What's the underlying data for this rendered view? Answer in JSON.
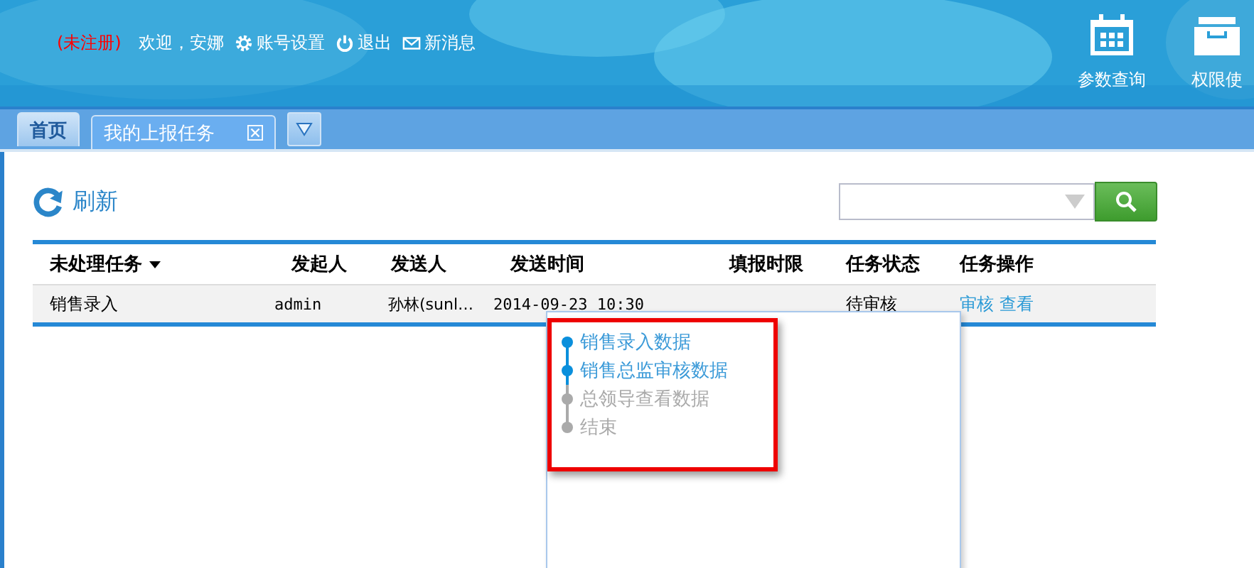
{
  "header": {
    "unregistered": "(未注册)",
    "welcome": "欢迎，安娜",
    "links": [
      {
        "kind": "gear",
        "label": "账号设置"
      },
      {
        "kind": "power",
        "label": "退出"
      },
      {
        "kind": "mail",
        "label": "新消息"
      }
    ],
    "shortcuts": [
      {
        "kind": "calendar",
        "label": "参数查询"
      },
      {
        "kind": "box",
        "label": "权限使"
      }
    ]
  },
  "tabs": [
    {
      "label": "首页",
      "selected": false,
      "closable": false
    },
    {
      "label": "我的上报任务",
      "selected": true,
      "closable": true
    }
  ],
  "toolbar": {
    "refresh": "刷新"
  },
  "table": {
    "columns": [
      "未处理任务",
      "发起人",
      "发送人",
      "发送时间",
      "填报时限",
      "任务状态",
      "任务操作"
    ],
    "rows": [
      {
        "cells": [
          "销售录入",
          "admin",
          "孙林(sunl…",
          "2014-09-23 10:30",
          "",
          "待审核"
        ],
        "actions": [
          "审核",
          "查看"
        ]
      }
    ]
  },
  "popup": {
    "steps": [
      {
        "label": "销售录入数据",
        "done": true
      },
      {
        "label": "销售总监审核数据",
        "done": true
      },
      {
        "label": "总领导查看数据",
        "done": false
      },
      {
        "label": "结束",
        "done": false
      }
    ]
  }
}
